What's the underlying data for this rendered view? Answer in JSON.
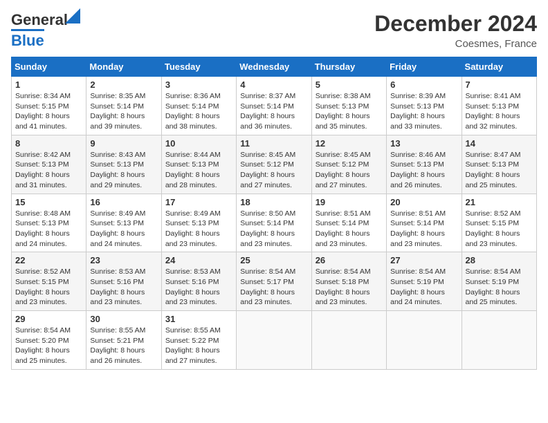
{
  "header": {
    "logo_line1": "General",
    "logo_line2": "Blue",
    "month_year": "December 2024",
    "location": "Coesmes, France"
  },
  "days_of_week": [
    "Sunday",
    "Monday",
    "Tuesday",
    "Wednesday",
    "Thursday",
    "Friday",
    "Saturday"
  ],
  "weeks": [
    [
      {
        "day": 1,
        "sunrise": "8:34 AM",
        "sunset": "5:15 PM",
        "daylight": "8 hours and 41 minutes."
      },
      {
        "day": 2,
        "sunrise": "8:35 AM",
        "sunset": "5:14 PM",
        "daylight": "8 hours and 39 minutes."
      },
      {
        "day": 3,
        "sunrise": "8:36 AM",
        "sunset": "5:14 PM",
        "daylight": "8 hours and 38 minutes."
      },
      {
        "day": 4,
        "sunrise": "8:37 AM",
        "sunset": "5:14 PM",
        "daylight": "8 hours and 36 minutes."
      },
      {
        "day": 5,
        "sunrise": "8:38 AM",
        "sunset": "5:13 PM",
        "daylight": "8 hours and 35 minutes."
      },
      {
        "day": 6,
        "sunrise": "8:39 AM",
        "sunset": "5:13 PM",
        "daylight": "8 hours and 33 minutes."
      },
      {
        "day": 7,
        "sunrise": "8:41 AM",
        "sunset": "5:13 PM",
        "daylight": "8 hours and 32 minutes."
      }
    ],
    [
      {
        "day": 8,
        "sunrise": "8:42 AM",
        "sunset": "5:13 PM",
        "daylight": "8 hours and 31 minutes."
      },
      {
        "day": 9,
        "sunrise": "8:43 AM",
        "sunset": "5:13 PM",
        "daylight": "8 hours and 29 minutes."
      },
      {
        "day": 10,
        "sunrise": "8:44 AM",
        "sunset": "5:13 PM",
        "daylight": "8 hours and 28 minutes."
      },
      {
        "day": 11,
        "sunrise": "8:45 AM",
        "sunset": "5:12 PM",
        "daylight": "8 hours and 27 minutes."
      },
      {
        "day": 12,
        "sunrise": "8:45 AM",
        "sunset": "5:12 PM",
        "daylight": "8 hours and 27 minutes."
      },
      {
        "day": 13,
        "sunrise": "8:46 AM",
        "sunset": "5:13 PM",
        "daylight": "8 hours and 26 minutes."
      },
      {
        "day": 14,
        "sunrise": "8:47 AM",
        "sunset": "5:13 PM",
        "daylight": "8 hours and 25 minutes."
      }
    ],
    [
      {
        "day": 15,
        "sunrise": "8:48 AM",
        "sunset": "5:13 PM",
        "daylight": "8 hours and 24 minutes."
      },
      {
        "day": 16,
        "sunrise": "8:49 AM",
        "sunset": "5:13 PM",
        "daylight": "8 hours and 24 minutes."
      },
      {
        "day": 17,
        "sunrise": "8:49 AM",
        "sunset": "5:13 PM",
        "daylight": "8 hours and 23 minutes."
      },
      {
        "day": 18,
        "sunrise": "8:50 AM",
        "sunset": "5:14 PM",
        "daylight": "8 hours and 23 minutes."
      },
      {
        "day": 19,
        "sunrise": "8:51 AM",
        "sunset": "5:14 PM",
        "daylight": "8 hours and 23 minutes."
      },
      {
        "day": 20,
        "sunrise": "8:51 AM",
        "sunset": "5:14 PM",
        "daylight": "8 hours and 23 minutes."
      },
      {
        "day": 21,
        "sunrise": "8:52 AM",
        "sunset": "5:15 PM",
        "daylight": "8 hours and 23 minutes."
      }
    ],
    [
      {
        "day": 22,
        "sunrise": "8:52 AM",
        "sunset": "5:15 PM",
        "daylight": "8 hours and 23 minutes."
      },
      {
        "day": 23,
        "sunrise": "8:53 AM",
        "sunset": "5:16 PM",
        "daylight": "8 hours and 23 minutes."
      },
      {
        "day": 24,
        "sunrise": "8:53 AM",
        "sunset": "5:16 PM",
        "daylight": "8 hours and 23 minutes."
      },
      {
        "day": 25,
        "sunrise": "8:54 AM",
        "sunset": "5:17 PM",
        "daylight": "8 hours and 23 minutes."
      },
      {
        "day": 26,
        "sunrise": "8:54 AM",
        "sunset": "5:18 PM",
        "daylight": "8 hours and 23 minutes."
      },
      {
        "day": 27,
        "sunrise": "8:54 AM",
        "sunset": "5:19 PM",
        "daylight": "8 hours and 24 minutes."
      },
      {
        "day": 28,
        "sunrise": "8:54 AM",
        "sunset": "5:19 PM",
        "daylight": "8 hours and 25 minutes."
      }
    ],
    [
      {
        "day": 29,
        "sunrise": "8:54 AM",
        "sunset": "5:20 PM",
        "daylight": "8 hours and 25 minutes."
      },
      {
        "day": 30,
        "sunrise": "8:55 AM",
        "sunset": "5:21 PM",
        "daylight": "8 hours and 26 minutes."
      },
      {
        "day": 31,
        "sunrise": "8:55 AM",
        "sunset": "5:22 PM",
        "daylight": "8 hours and 27 minutes."
      },
      null,
      null,
      null,
      null
    ]
  ]
}
